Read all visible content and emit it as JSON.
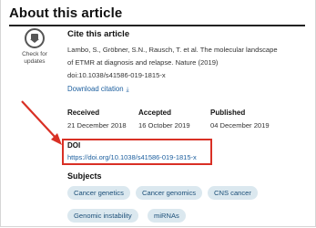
{
  "section": {
    "title": "About this article"
  },
  "badge": {
    "label_line1": "Check for",
    "label_line2": "updates"
  },
  "cite": {
    "heading": "Cite this article",
    "line1": "Lambo, S., Gröbner, S.N., Rausch, T. et al. The molecular landscape",
    "line2": "of ETMR at diagnosis and relapse. Nature (2019)",
    "line3": "doi:10.1038/s41586-019-1815-x",
    "download_label": "Download citation"
  },
  "dates": {
    "received_label": "Received",
    "received_value": "21 December 2018",
    "accepted_label": "Accepted",
    "accepted_value": "16 October 2019",
    "published_label": "Published",
    "published_value": "04 December 2019"
  },
  "doi": {
    "label": "DOI",
    "url": "https://doi.org/10.1038/s41586-019-1815-x"
  },
  "subjects": {
    "heading": "Subjects",
    "tags": [
      "Cancer genetics",
      "Cancer genomics",
      "CNS cancer",
      "Genomic instability",
      "miRNAs"
    ]
  },
  "colors": {
    "highlight": "#d93025",
    "link": "#1b5e9e",
    "chip_bg": "#dbe8ef"
  },
  "icons": {
    "badge": "check-for-updates-icon",
    "download": "download-arrow-icon"
  }
}
